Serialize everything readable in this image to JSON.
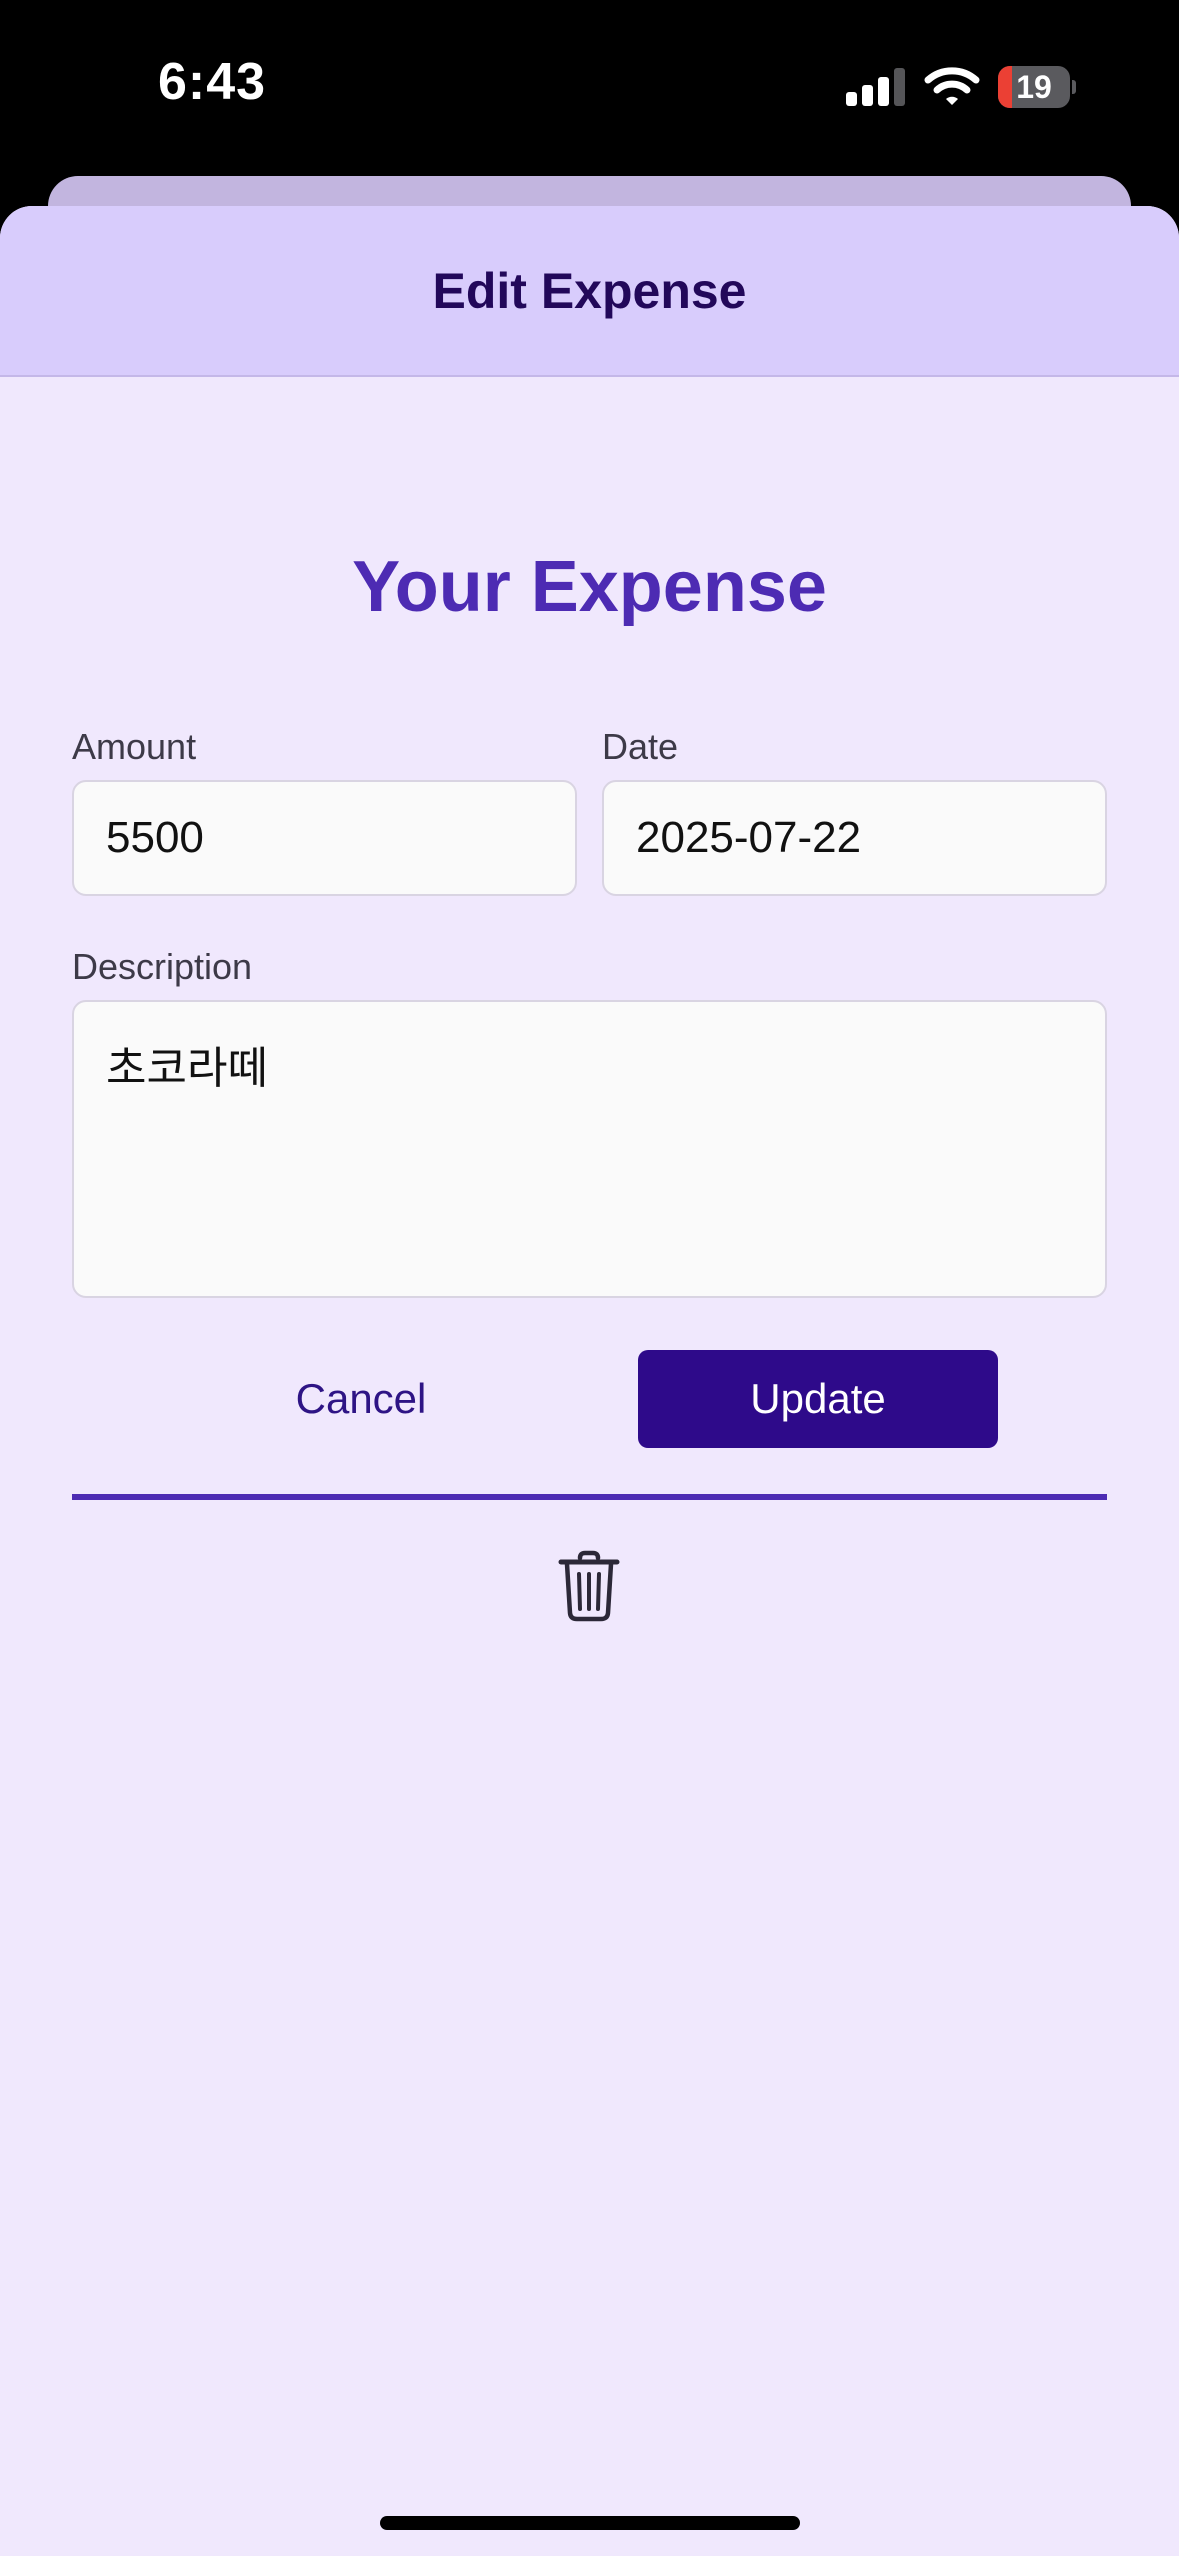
{
  "status_bar": {
    "time": "6:43",
    "battery_level": "19",
    "battery_fraction": 0.19,
    "battery_color": "#eb4034",
    "icons": [
      "cellular-signal-icon",
      "wifi-icon",
      "battery-icon"
    ]
  },
  "header": {
    "title": "Edit Expense"
  },
  "form": {
    "title": "Your Expense",
    "amount": {
      "label": "Amount",
      "value": "5500"
    },
    "date": {
      "label": "Date",
      "value": "2025-07-22"
    },
    "description": {
      "label": "Description",
      "value": "초코라떼"
    },
    "cancel_label": "Cancel",
    "update_label": "Update",
    "delete_icon": "trash-icon"
  },
  "colors": {
    "accent": "#4d2bb3",
    "primary_button": "#2e0a8a",
    "header_bg": "#d8ccfc",
    "sheet_bg": "#f0e8fd"
  }
}
